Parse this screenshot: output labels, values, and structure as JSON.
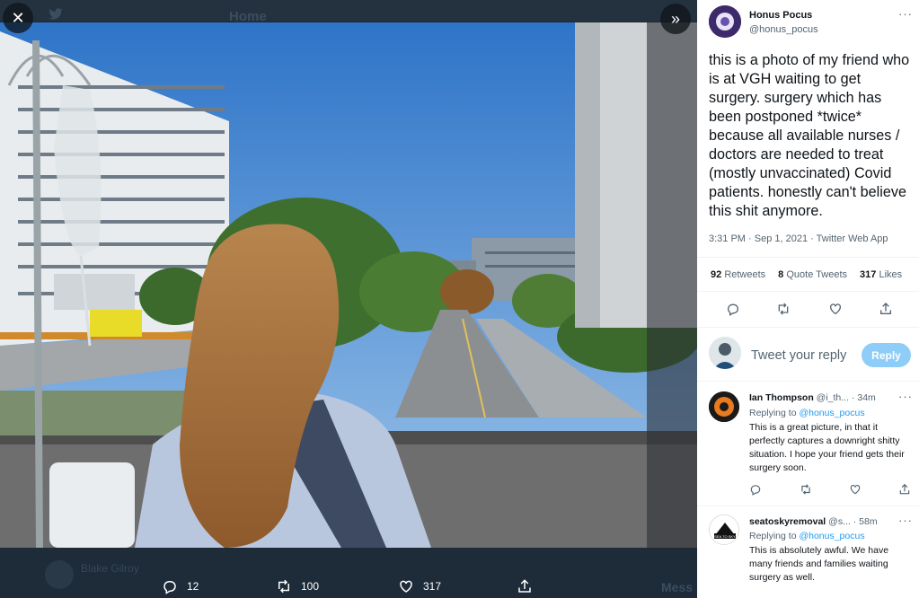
{
  "background": {
    "home_label": "Home",
    "user_name": "Blake Gilroy",
    "user_handle": "@",
    "messages_label": "Mess"
  },
  "viewer": {
    "close_icon": "close-icon",
    "expand_icon": "double-chevron-right-icon",
    "actions": {
      "replies": "12",
      "retweets": "100",
      "likes": "317"
    }
  },
  "tweet": {
    "author_name": "Honus Pocus",
    "author_handle": "@honus_pocus",
    "text": "this is a photo of my friend who is at VGH waiting to get surgery. surgery which has been postponed *twice* because all available nurses / doctors are needed to treat (mostly unvaccinated) Covid patients. honestly can't believe this shit anymore.",
    "meta": "3:31 PM · Sep 1, 2021 · Twitter Web App",
    "stats": {
      "retweets_count": "92",
      "retweets_label": "Retweets",
      "quotes_count": "8",
      "quotes_label": "Quote Tweets",
      "likes_count": "317",
      "likes_label": "Likes"
    }
  },
  "compose": {
    "placeholder": "Tweet your reply",
    "button_label": "Reply"
  },
  "replies": [
    {
      "name": "Ian Thompson",
      "handle": "@i_th...",
      "time": "· 34m",
      "replying_prefix": "Replying to",
      "replying_to": "@honus_pocus",
      "text": "This is a great picture, in that it perfectly captures a downright shitty situation. I hope your friend gets their surgery soon."
    },
    {
      "name": "seatoskyremoval",
      "handle": "@s...",
      "time": "· 58m",
      "replying_prefix": "Replying to",
      "replying_to": "@honus_pocus",
      "text": "This is absolutely awful. We have many friends and families waiting surgery as well.",
      "avatar_text": "SEA TO SKY"
    }
  ],
  "colors": {
    "accent": "#1d9bf0",
    "reply_button": "#8ecdf8",
    "dark_bg": "#15202b",
    "secondary_text": "#536471"
  }
}
